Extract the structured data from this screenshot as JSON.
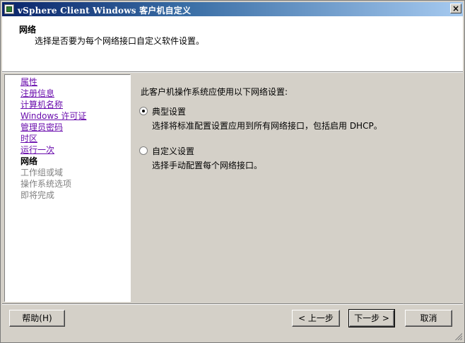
{
  "window": {
    "title": "vSphere Client Windows 客户机自定义",
    "close_glyph": "×"
  },
  "header": {
    "title": "网络",
    "subtitle": "选择是否要为每个网络接口自定义软件设置。"
  },
  "sidebar": {
    "items": [
      {
        "label": "属性",
        "state": "visited-link"
      },
      {
        "label": "注册信息",
        "state": "visited-link"
      },
      {
        "label": "计算机名称",
        "state": "visited-link"
      },
      {
        "label": "Windows 许可证",
        "state": "visited-link"
      },
      {
        "label": "管理员密码",
        "state": "visited-link"
      },
      {
        "label": "时区",
        "state": "visited-link"
      },
      {
        "label": "运行一次",
        "state": "visited-link"
      },
      {
        "label": "网络",
        "state": "current"
      },
      {
        "label": "工作组或域",
        "state": "disabled"
      },
      {
        "label": "操作系统选项",
        "state": "disabled"
      },
      {
        "label": "即将完成",
        "state": "disabled"
      }
    ]
  },
  "main": {
    "intro": "此客户机操作系统应使用以下网络设置:",
    "options": [
      {
        "label": "典型设置",
        "description": "选择将标准配置设置应用到所有网络接口，包括启用 DHCP。",
        "selected": true
      },
      {
        "label": "自定义设置",
        "description": "选择手动配置每个网络接口。",
        "selected": false
      }
    ]
  },
  "footer": {
    "help_label": "帮助(H)",
    "back_label": "< 上一步",
    "next_label": "下一步 >",
    "cancel_label": "取消"
  },
  "colors": {
    "titlebar": "#0a246a",
    "face": "#d4d0c8",
    "visited_link": "#6a0dad",
    "disabled_text": "#808080"
  }
}
